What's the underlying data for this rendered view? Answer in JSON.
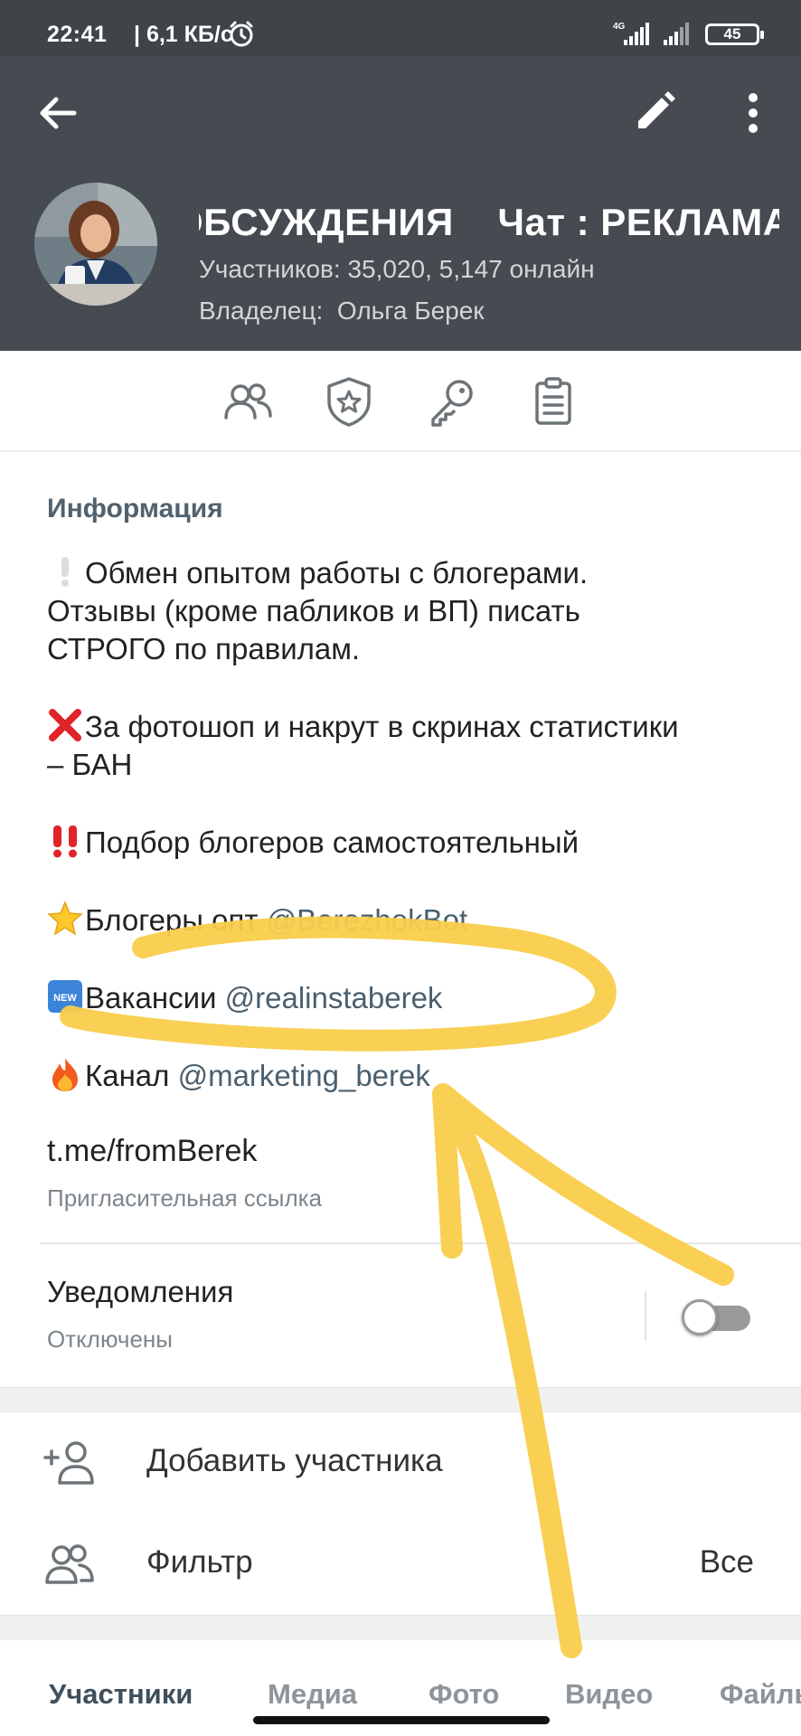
{
  "status_bar": {
    "time": "22:41",
    "network_speed": "| 6,1 КБ/с",
    "signal_label": "4G",
    "battery": "45",
    "icons": [
      "alarm-icon",
      "signal-4g-icon",
      "signal-icon",
      "battery-icon"
    ]
  },
  "header": {
    "title": "ОБСУЖДЕНИЯ    Чат : РЕКЛАМА",
    "members": "Участников: 35,020, 5,147 онлайн",
    "owner": "Владелец:  Ольга Берек",
    "background_color": "#454b50",
    "icons": [
      "back-arrow-icon",
      "edit-pencil-icon",
      "more-vert-icon"
    ]
  },
  "actions": {
    "icons": [
      "members-icon",
      "admins-shield-star-icon",
      "permissions-key-icon",
      "clipboard-icon"
    ]
  },
  "info": {
    "heading": "Информация",
    "lines": {
      "l1": "Обмен опытом работы с блогерами.",
      "l2": "Отзывы (кроме пабликов и ВП) писать",
      "l3": "СТРОГО по правилам.",
      "l4": "За фотошоп и накрут в скринах статистики",
      "l5": "– БАН",
      "l6": "Подбор блогеров самостоятельный",
      "l7_text": "Блогеры опт ",
      "l7_link": "@BerezhokBot",
      "l8_text": "Вакансии ",
      "l8_link": "@realinstaberek",
      "l9_text": "Канал ",
      "l9_link": "@marketing_berek"
    },
    "emoji": {
      "e1": "white-exclamation-emoji",
      "e2": "red-cross-emoji",
      "e3": "double-exclamation-emoji",
      "e4": "star-emoji",
      "e5": "new-badge-emoji",
      "e6": "fire-emoji"
    },
    "invite_link": "t.me/fromBerek",
    "invite_caption": "Пригласительная ссылка"
  },
  "notifications": {
    "title": "Уведомления",
    "state": "Отключены",
    "toggle_on": false
  },
  "rows": {
    "add_member": "Добавить участника",
    "filter": "Фильтр",
    "filter_value": "Все"
  },
  "tabs": [
    "Участники",
    "Медиа",
    "Фото",
    "Видео",
    "Файлы"
  ],
  "annotation_color": "#f9cd4b"
}
